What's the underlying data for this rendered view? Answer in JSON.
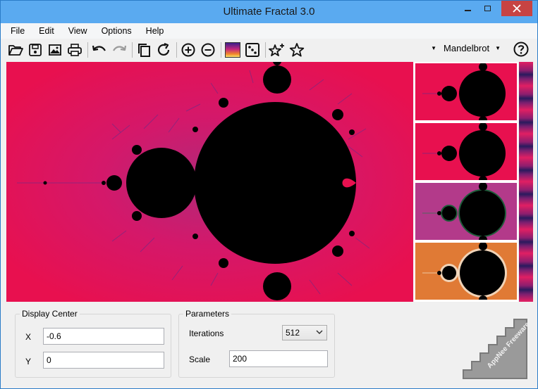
{
  "window": {
    "title": "Ultimate Fractal 3.0"
  },
  "menu": [
    "File",
    "Edit",
    "View",
    "Options",
    "Help"
  ],
  "toolbar": {
    "icons": [
      "open-folder-icon",
      "save-icon",
      "image-icon",
      "print-icon",
      "undo-icon",
      "redo-icon",
      "copy-icon",
      "refresh-icon",
      "zoom-in-icon",
      "zoom-out-icon",
      "gradient-icon",
      "dice-icon",
      "add-favorite-icon",
      "favorite-icon"
    ],
    "fractal_type": "Mandelbrot",
    "help_icon": "help-icon"
  },
  "display_center": {
    "title": "Display Center",
    "x_label": "X",
    "x_value": "-0.6",
    "y_label": "Y",
    "y_value": "0"
  },
  "parameters": {
    "title": "Parameters",
    "iterations_label": "Iterations",
    "iterations_value": "512",
    "scale_label": "Scale",
    "scale_value": "200"
  },
  "watermark": {
    "text": "AppNee Freeware Group."
  },
  "colors": {
    "fractal_background": "#e8104f",
    "thumb_3_background": "#b33a8a",
    "thumb_4_background": "#e07a35",
    "title_bar": "#5aaaf0",
    "close_button": "#c74343"
  }
}
